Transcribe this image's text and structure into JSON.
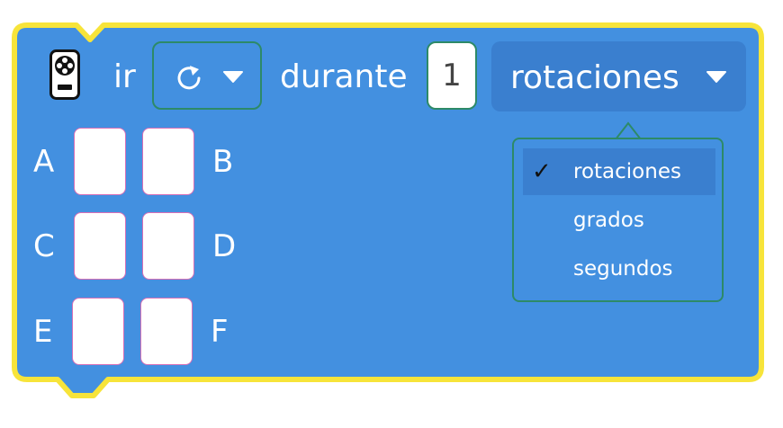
{
  "block": {
    "ir_label": "ir",
    "direction_field": {
      "icon": "rotate-clockwise-icon"
    },
    "durante_label": "durante",
    "amount_value": "1",
    "unit_value": "rotaciones",
    "hub_icon": "motor-hub-icon"
  },
  "ports": [
    {
      "label": "A"
    },
    {
      "label": "B"
    },
    {
      "label": "C"
    },
    {
      "label": "D"
    },
    {
      "label": "E"
    },
    {
      "label": "F"
    }
  ],
  "dropdown": {
    "items": [
      {
        "label": "rotaciones",
        "selected": true
      },
      {
        "label": "grados",
        "selected": false
      },
      {
        "label": "segundos",
        "selected": false
      }
    ]
  },
  "colors": {
    "block_fill": "#4390e0",
    "block_outline": "#f7e43a",
    "field_border": "#2d8a68",
    "unit_field_bg": "#3a7fcf",
    "port_border": "#d86fb6"
  }
}
